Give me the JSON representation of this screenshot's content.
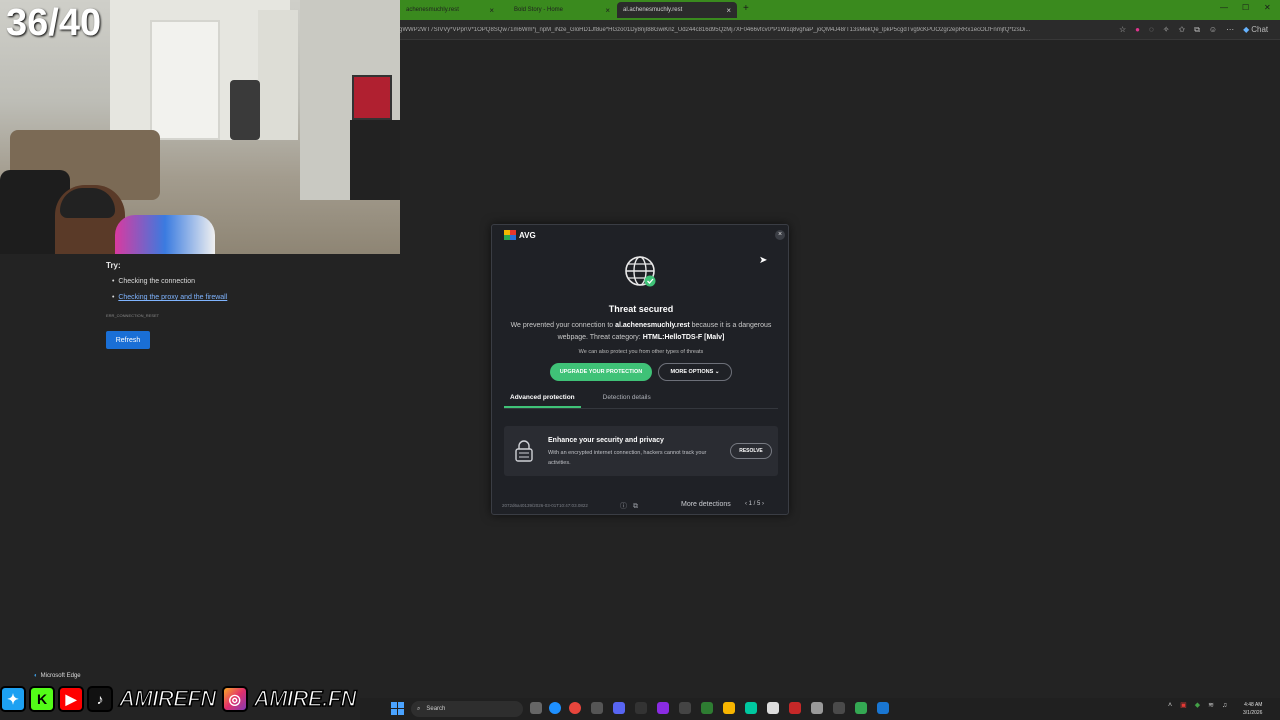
{
  "browser": {
    "tabs": [
      {
        "label": "achenesmuchly.rest"
      },
      {
        "label": "Bold Story - Home"
      },
      {
        "label": "al.achenesmuchly.rest"
      }
    ],
    "new_tab": "+",
    "url": "gWWP2WT7SIVVy*VPpr\\V*1OPQ8SQw71m6Wm*j_npM_iNze_GloHD1Jf8ue*HGzo01Dy8njI88GwiKnz_Ud244c816d95QzMj7XF0466vfcv0*P1W1q8vghaP_joQM4J48rT13sMekQe_lpkP5cgdTvg9cKPUO2gr2epRRx1ecOLfFnmjfQ*t2sDi...",
    "chat_label": "Chat"
  },
  "overlay": {
    "counter": "36/40"
  },
  "error_page": {
    "try_label": "Try:",
    "suggestions": [
      "Checking the connection",
      "Checking the proxy and the firewall"
    ],
    "error_code": "ERR_CONNECTION_RESET",
    "refresh_label": "Refresh"
  },
  "avg": {
    "brand": "AVG",
    "close": "×",
    "title": "Threat secured",
    "msg_prefix": "We prevented your connection to ",
    "domain": "al.achenesmuchly.rest",
    "msg_mid": " because it is a dangerous webpage. Threat category: ",
    "category": "HTML:HelloTDS-F [Malv]",
    "protect_msg": "We can also protect you from other types of threats",
    "upgrade_label": "UPGRADE YOUR PROTECTION",
    "options_label": "MORE OPTIONS",
    "tabs": [
      "Advanced protection",
      "Detection details"
    ],
    "card": {
      "title": "Enhance your security and privacy",
      "desc": "With an encrypted internet connection, hackers cannot track your activities.",
      "button": "RESOLVE"
    },
    "footer_id": "2072d6a40139/2026-03-01T10:47:03.0822",
    "more_detections": "More detections",
    "pager": "‹  1 / 5  ›"
  },
  "social": {
    "handle_1": "AMIREFN",
    "handle_2": "AMIRE.FN"
  },
  "taskbar": {
    "edge_label": "Microsoft Edge",
    "search_label": "Search",
    "time": "4:48 AM",
    "date": "3/1/2026"
  },
  "colors": {
    "browser_accent": "#3a8a1e",
    "avg_green": "#3fc277",
    "refresh_blue": "#1a6fd6"
  }
}
